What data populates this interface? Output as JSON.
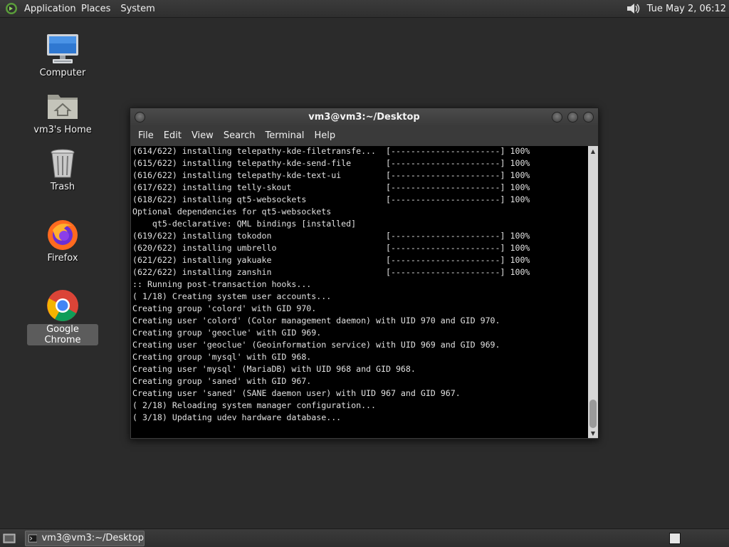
{
  "top_panel": {
    "menu": [
      "Applications",
      "Places",
      "System"
    ],
    "clock": "Tue May  2, 06:12"
  },
  "desktop": {
    "icons": [
      {
        "label": "Computer",
        "icon": "computer-icon"
      },
      {
        "label": "vm3's Home",
        "icon": "home-folder-icon"
      },
      {
        "label": "Trash",
        "icon": "trash-icon"
      },
      {
        "label": "Firefox",
        "icon": "firefox-icon"
      },
      {
        "label": "Google Chrome",
        "icon": "chrome-icon"
      }
    ]
  },
  "window": {
    "title": "vm3@vm3:~/Desktop",
    "menu": [
      "File",
      "Edit",
      "View",
      "Search",
      "Terminal",
      "Help"
    ],
    "terminal_lines": [
      "(614/622) installing telepathy-kde-filetransfe...  [----------------------] 100%",
      "(615/622) installing telepathy-kde-send-file       [----------------------] 100%",
      "(616/622) installing telepathy-kde-text-ui         [----------------------] 100%",
      "(617/622) installing telly-skout                   [----------------------] 100%",
      "(618/622) installing qt5-websockets                [----------------------] 100%",
      "Optional dependencies for qt5-websockets",
      "    qt5-declarative: QML bindings [installed]",
      "(619/622) installing tokodon                       [----------------------] 100%",
      "(620/622) installing umbrello                      [----------------------] 100%",
      "(621/622) installing yakuake                       [----------------------] 100%",
      "(622/622) installing zanshin                       [----------------------] 100%",
      ":: Running post-transaction hooks...",
      "( 1/18) Creating system user accounts...",
      "Creating group 'colord' with GID 970.",
      "Creating user 'colord' (Color management daemon) with UID 970 and GID 970.",
      "Creating group 'geoclue' with GID 969.",
      "Creating user 'geoclue' (Geoinformation service) with UID 969 and GID 969.",
      "Creating group 'mysql' with GID 968.",
      "Creating user 'mysql' (MariaDB) with UID 968 and GID 968.",
      "Creating group 'saned' with GID 967.",
      "Creating user 'saned' (SANE daemon user) with UID 967 and GID 967.",
      "( 2/18) Reloading system manager configuration...",
      "( 3/18) Updating udev hardware database..."
    ]
  },
  "bottom_panel": {
    "task_label": "vm3@vm3:~/Desktop"
  }
}
